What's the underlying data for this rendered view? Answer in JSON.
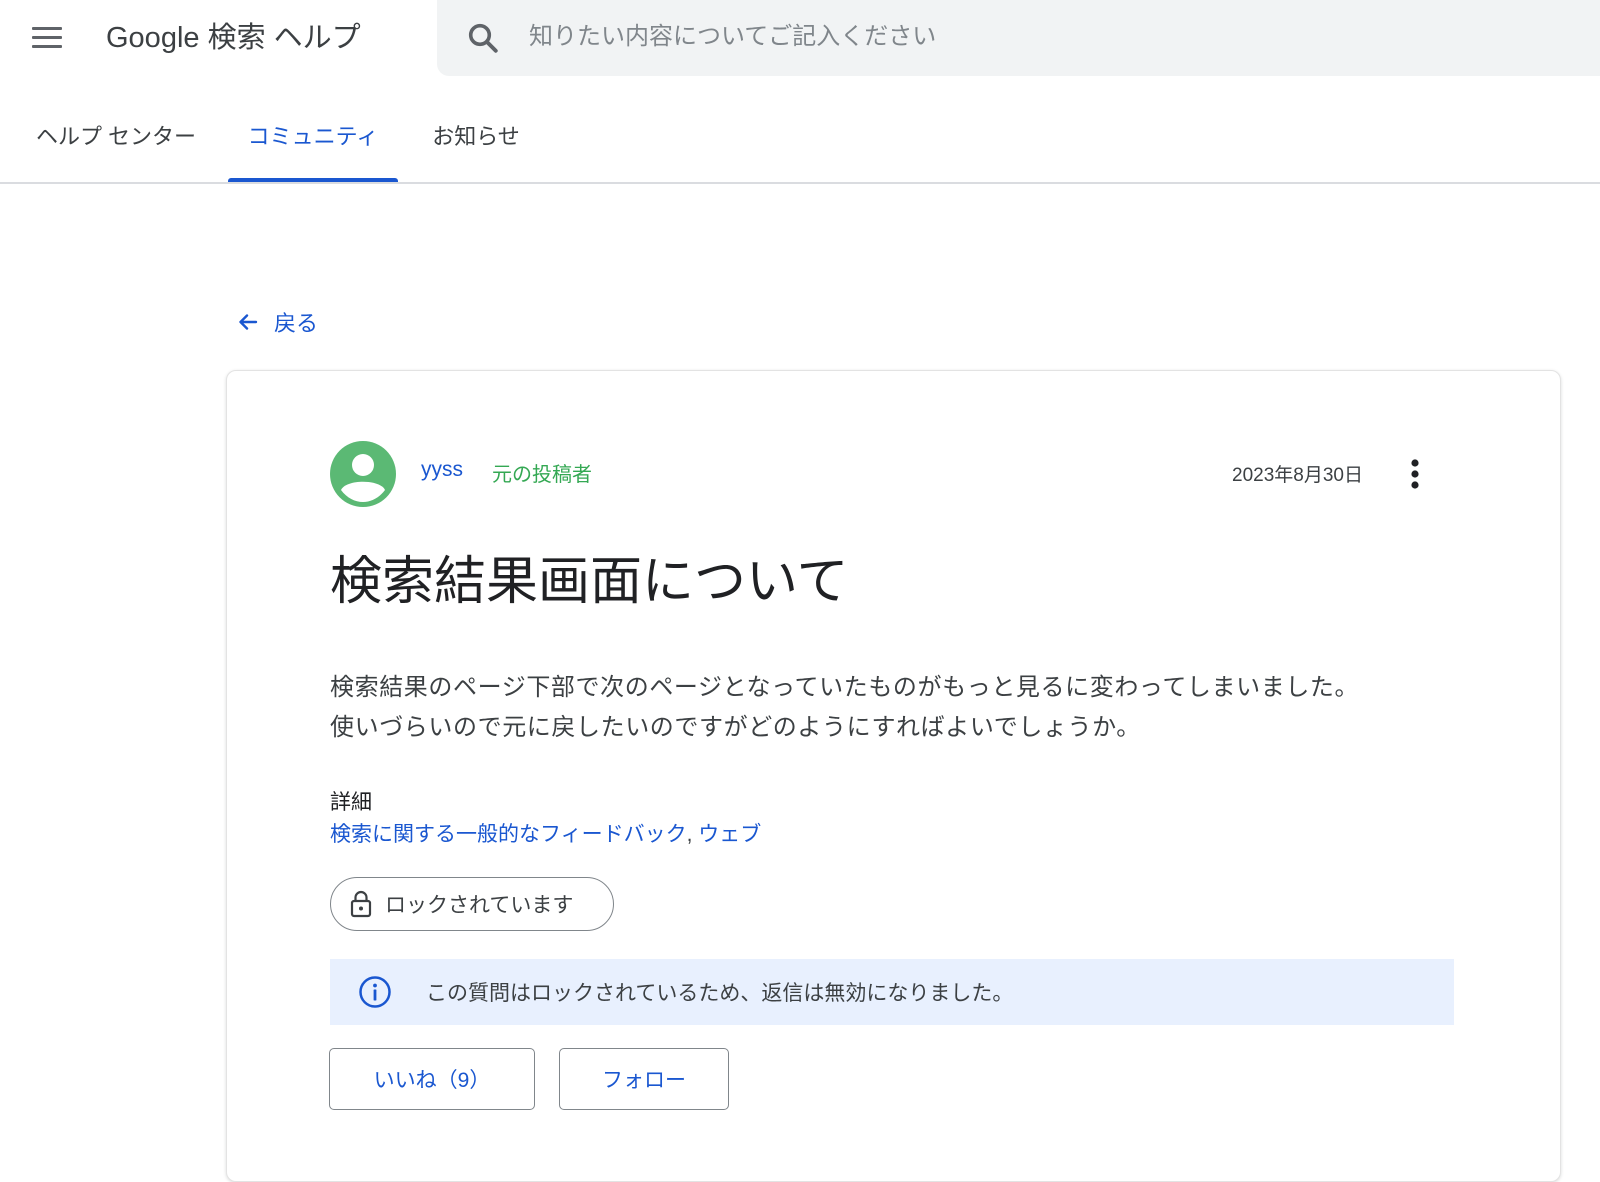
{
  "header": {
    "app_title": "Google 検索 ヘルプ",
    "search_placeholder": "知りたい内容についてご記入ください",
    "icons": {
      "menu": "menu-icon",
      "search": "search-icon"
    }
  },
  "tabs": [
    {
      "label": "ヘルプ センター",
      "active": false
    },
    {
      "label": "コミュニティ",
      "active": true
    },
    {
      "label": "お知らせ",
      "active": false
    }
  ],
  "back": {
    "label": "戻る",
    "icon": "arrow-back-icon"
  },
  "post": {
    "author": "yyss",
    "author_badge": "元の投稿者",
    "date": "2023年8月30日",
    "title": "検索結果画面について",
    "body_lines": [
      "検索結果のページ下部で次のページとなっていたものがもっと見るに変わってしまいました。",
      "使いづらいので元に戻したいのですがどのようにすればよいでしょうか。"
    ],
    "details_label": "詳細",
    "details_links": [
      "検索に関する一般的なフィードバック",
      "ウェブ"
    ],
    "details_separator": ", ",
    "lock_status": "ロックされています",
    "locked_notice": "この質問はロックされているため、返信は無効になりました。",
    "like_button": "いいね（9）",
    "follow_button": "フォロー"
  },
  "colors": {
    "accent": "#1a57d0",
    "badge_green": "#34a853",
    "avatar_green": "#5bb974",
    "info_banner_bg": "#e8f0fe",
    "search_bg": "#f1f3f4"
  }
}
